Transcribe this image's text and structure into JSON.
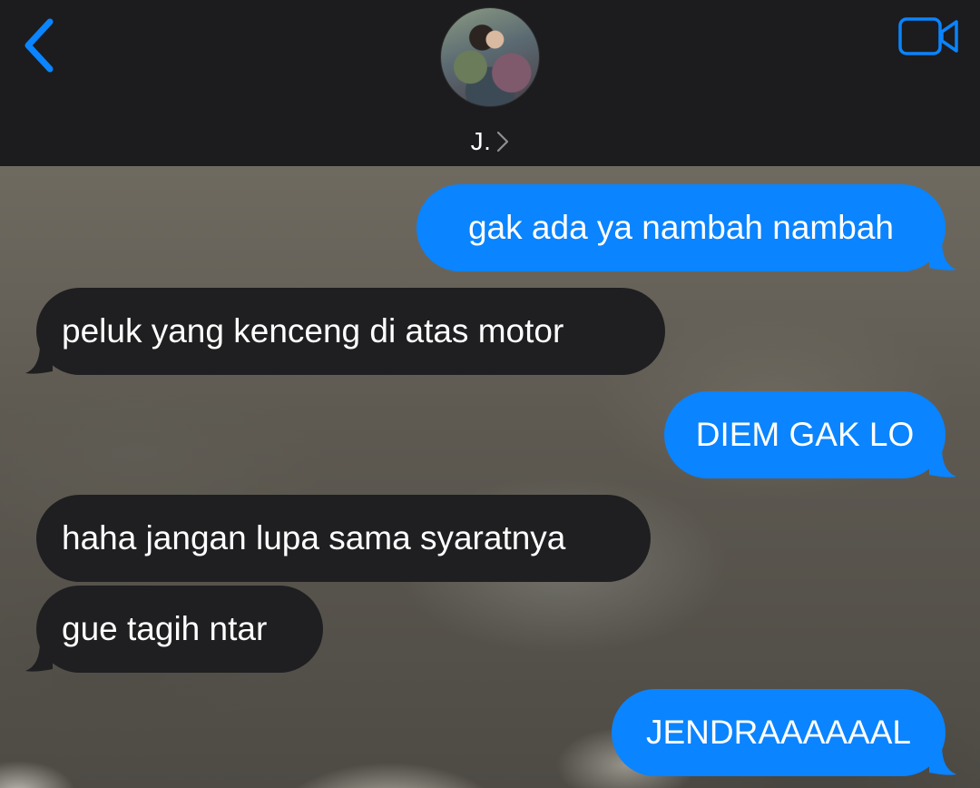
{
  "header": {
    "contact_name": "J.",
    "back_icon": "chevron-left-icon",
    "info_icon": "chevron-right-icon",
    "video_icon": "video-camera-icon",
    "accent_color": "#0a84ff"
  },
  "messages": [
    {
      "direction": "sent",
      "text": "gak ada ya nambah nambah"
    },
    {
      "direction": "received",
      "text": "peluk yang kenceng di atas motor"
    },
    {
      "direction": "sent",
      "text": "DIEM GAK LO"
    },
    {
      "direction": "received",
      "text": "haha jangan lupa sama syaratnya"
    },
    {
      "direction": "received",
      "text": "gue tagih ntar"
    },
    {
      "direction": "sent",
      "text": "JENDRAAAAAAL"
    }
  ],
  "colors": {
    "sent_bubble": "#0a84ff",
    "received_bubble": "#1f1f21",
    "header_background": "#1c1c1e"
  }
}
